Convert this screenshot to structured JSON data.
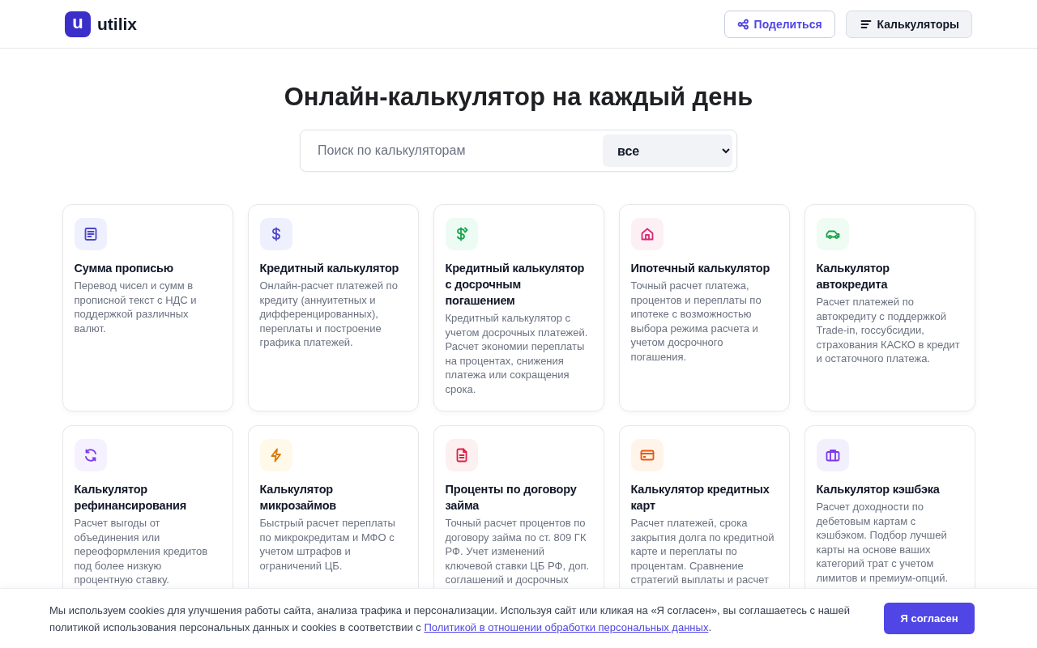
{
  "header": {
    "logo": {
      "mark": "u",
      "text": "utilix"
    },
    "buttons": [
      {
        "kind": "share",
        "label": "Поделиться"
      },
      {
        "kind": "menu",
        "label": "Калькуляторы"
      }
    ]
  },
  "title": "Онлайн-калькулятор на каждый день",
  "search": {
    "placeholder": "Поиск по калькуляторам",
    "category": "все"
  },
  "cards": [
    {
      "kind": "document",
      "title": "Сумма прописью",
      "description": "Перевод чисел и сумм в прописной текст с НДС и поддержкой различных валют."
    },
    {
      "kind": "dollar",
      "title": "Кредитный калькулятор",
      "description": "Онлайн-расчет платежей по кредиту (аннуитетных и дифференцированных), переплаты и построение графика платежей."
    },
    {
      "kind": "dollar-arrows",
      "title": "Кредитный калькулятор с досрочным погашением",
      "description": "Кредитный калькулятор с учетом досрочных платежей. Расчет экономии переплаты на процентах, снижения платежа или сокращения срока."
    },
    {
      "kind": "house",
      "title": "Ипотечный калькулятор",
      "description": "Точный расчет платежа, процентов и переплаты по ипотеке с возможностью выбора режима расчета и учетом досрочного погашения."
    },
    {
      "kind": "car",
      "title": "Калькулятор автокредита",
      "description": "Расчет платежей по автокредиту с поддержкой Trade-in, госсубсидии, страхования КАСКО в кредит и остаточного платежа."
    },
    {
      "kind": "refresh",
      "title": "Калькулятор рефинансирования",
      "description": "Расчет выгоды от объединения или переоформления кредитов под более низкую процентную ставку."
    },
    {
      "kind": "lightning",
      "title": "Калькулятор микрозаймов",
      "description": "Быстрый расчет переплаты по микрокредитам и МФО с учетом штрафов и ограничений ЦБ."
    },
    {
      "kind": "file",
      "title": "Проценты по договору займа",
      "description": "Точный расчет процентов по договору займа по ст. 809 ГК РФ. Учет изменений ключевой ставки ЦБ РФ, доп. соглашений и досрочных"
    },
    {
      "kind": "card",
      "title": "Калькулятор кредитных карт",
      "description": "Расчет платежей, срока закрытия долга по кредитной карте и переплаты по процентам. Сравнение стратегий выплаты и расчет"
    },
    {
      "kind": "briefcase",
      "title": "Калькулятор кэшбэка",
      "description": "Расчет доходности по дебетовым картам с кэшбэком. Подбор лучшей карты на основе ваших категорий трат с учетом лимитов и премиум-опций."
    }
  ],
  "cookie_banner": {
    "text": "Мы используем cookies для улучшения работы сайта, анализа трафика и персонализации. Используя сайт или кликая на «Я согласен», вы соглашаетесь с нашей политикой использования персональных данных и cookies в соответствии с ",
    "link": "Политикой в отношении обработки персональных данных",
    "text_end": ".",
    "button": "Я согласен"
  }
}
